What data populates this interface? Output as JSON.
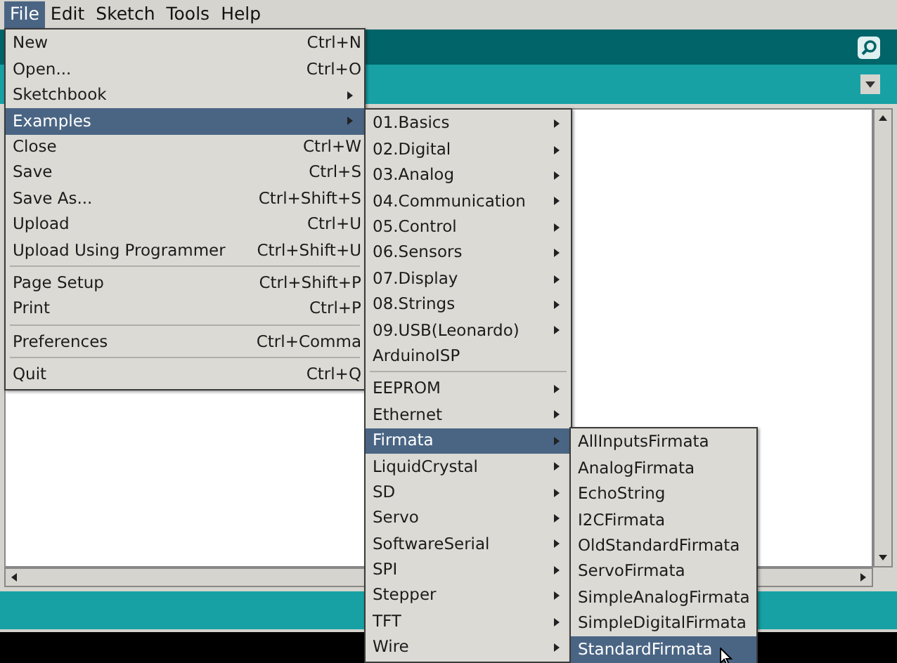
{
  "menubar": [
    {
      "label": "File",
      "selected": true
    },
    {
      "label": "Edit",
      "selected": false
    },
    {
      "label": "Sketch",
      "selected": false
    },
    {
      "label": "Tools",
      "selected": false
    },
    {
      "label": "Help",
      "selected": false
    }
  ],
  "file_menu": [
    {
      "kind": "item",
      "label": "New",
      "shortcut": "Ctrl+N",
      "selected": false
    },
    {
      "kind": "item",
      "label": "Open...",
      "shortcut": "Ctrl+O",
      "selected": false
    },
    {
      "kind": "item",
      "label": "Sketchbook",
      "submenu": true,
      "selected": false
    },
    {
      "kind": "item",
      "label": "Examples",
      "submenu": true,
      "selected": true
    },
    {
      "kind": "item",
      "label": "Close",
      "shortcut": "Ctrl+W",
      "selected": false
    },
    {
      "kind": "item",
      "label": "Save",
      "shortcut": "Ctrl+S",
      "selected": false
    },
    {
      "kind": "item",
      "label": "Save As...",
      "shortcut": "Ctrl+Shift+S",
      "selected": false
    },
    {
      "kind": "item",
      "label": "Upload",
      "shortcut": "Ctrl+U",
      "selected": false
    },
    {
      "kind": "item",
      "label": "Upload Using Programmer",
      "shortcut": "Ctrl+Shift+U",
      "selected": false
    },
    {
      "kind": "separator"
    },
    {
      "kind": "item",
      "label": "Page Setup",
      "shortcut": "Ctrl+Shift+P",
      "selected": false
    },
    {
      "kind": "item",
      "label": "Print",
      "shortcut": "Ctrl+P",
      "selected": false
    },
    {
      "kind": "separator"
    },
    {
      "kind": "item",
      "label": "Preferences",
      "shortcut": "Ctrl+Comma",
      "selected": false
    },
    {
      "kind": "separator"
    },
    {
      "kind": "item",
      "label": "Quit",
      "shortcut": "Ctrl+Q",
      "selected": false
    }
  ],
  "examples_menu": [
    {
      "kind": "item",
      "label": "01.Basics",
      "submenu": true,
      "selected": false
    },
    {
      "kind": "item",
      "label": "02.Digital",
      "submenu": true,
      "selected": false
    },
    {
      "kind": "item",
      "label": "03.Analog",
      "submenu": true,
      "selected": false
    },
    {
      "kind": "item",
      "label": "04.Communication",
      "submenu": true,
      "selected": false
    },
    {
      "kind": "item",
      "label": "05.Control",
      "submenu": true,
      "selected": false
    },
    {
      "kind": "item",
      "label": "06.Sensors",
      "submenu": true,
      "selected": false
    },
    {
      "kind": "item",
      "label": "07.Display",
      "submenu": true,
      "selected": false
    },
    {
      "kind": "item",
      "label": "08.Strings",
      "submenu": true,
      "selected": false
    },
    {
      "kind": "item",
      "label": "09.USB(Leonardo)",
      "submenu": true,
      "selected": false
    },
    {
      "kind": "item",
      "label": "ArduinoISP",
      "submenu": false,
      "selected": false
    },
    {
      "kind": "separator"
    },
    {
      "kind": "item",
      "label": "EEPROM",
      "submenu": true,
      "selected": false
    },
    {
      "kind": "item",
      "label": "Ethernet",
      "submenu": true,
      "selected": false
    },
    {
      "kind": "item",
      "label": "Firmata",
      "submenu": true,
      "selected": true
    },
    {
      "kind": "item",
      "label": "LiquidCrystal",
      "submenu": true,
      "selected": false
    },
    {
      "kind": "item",
      "label": "SD",
      "submenu": true,
      "selected": false
    },
    {
      "kind": "item",
      "label": "Servo",
      "submenu": true,
      "selected": false
    },
    {
      "kind": "item",
      "label": "SoftwareSerial",
      "submenu": true,
      "selected": false
    },
    {
      "kind": "item",
      "label": "SPI",
      "submenu": true,
      "selected": false
    },
    {
      "kind": "item",
      "label": "Stepper",
      "submenu": true,
      "selected": false
    },
    {
      "kind": "item",
      "label": "TFT",
      "submenu": true,
      "selected": false
    },
    {
      "kind": "item",
      "label": "Wire",
      "submenu": true,
      "selected": false
    }
  ],
  "firmata_menu": [
    {
      "kind": "item",
      "label": "AllInputsFirmata",
      "selected": false
    },
    {
      "kind": "item",
      "label": "AnalogFirmata",
      "selected": false
    },
    {
      "kind": "item",
      "label": "EchoString",
      "selected": false
    },
    {
      "kind": "item",
      "label": "I2CFirmata",
      "selected": false
    },
    {
      "kind": "item",
      "label": "OldStandardFirmata",
      "selected": false
    },
    {
      "kind": "item",
      "label": "ServoFirmata",
      "selected": false
    },
    {
      "kind": "item",
      "label": "SimpleAnalogFirmata",
      "selected": false
    },
    {
      "kind": "item",
      "label": "SimpleDigitalFirmata",
      "selected": false
    },
    {
      "kind": "item",
      "label": "StandardFirmata",
      "selected": true
    }
  ]
}
